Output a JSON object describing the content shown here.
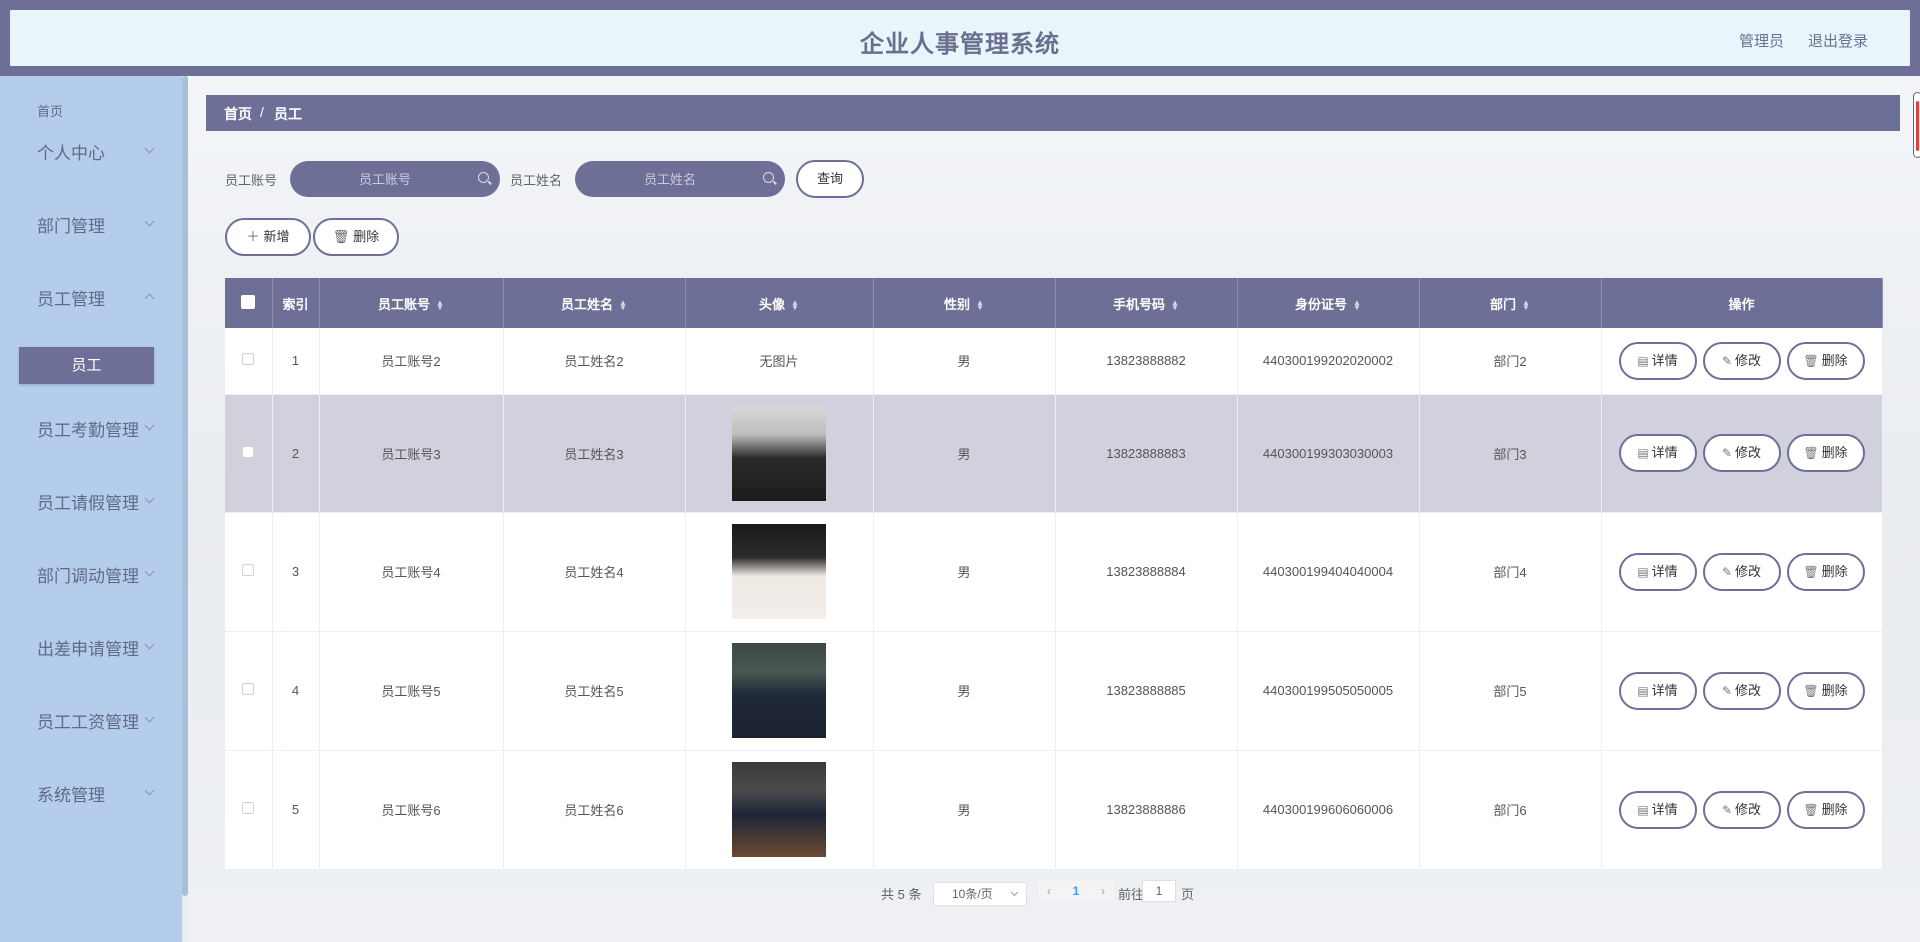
{
  "header": {
    "title": "企业人事管理系统",
    "user": "管理员",
    "logout": "退出登录"
  },
  "sidebar": {
    "home": "首页",
    "items": [
      {
        "label": "个人中心"
      },
      {
        "label": "部门管理"
      },
      {
        "label": "员工管理"
      },
      {
        "label": "员工考勤管理"
      },
      {
        "label": "员工请假管理"
      },
      {
        "label": "部门调动管理"
      },
      {
        "label": "出差申请管理"
      },
      {
        "label": "员工工资管理"
      },
      {
        "label": "系统管理"
      }
    ],
    "active_sub": "员工"
  },
  "breadcrumb": {
    "home": "首页",
    "sep": "/",
    "current": "员工"
  },
  "search": {
    "account_label": "员工账号",
    "account_placeholder": "员工账号",
    "name_label": "员工姓名",
    "name_placeholder": "员工姓名",
    "query": "查询"
  },
  "toolbar": {
    "add": "新增",
    "delete": "删除"
  },
  "table": {
    "headers": [
      "索引",
      "员工账号",
      "员工姓名",
      "头像",
      "性别",
      "手机号码",
      "身份证号",
      "部门",
      "操作"
    ],
    "rows": [
      {
        "index": "1",
        "account": "员工账号2",
        "name": "员工姓名2",
        "avatar": "无图片",
        "gender": "男",
        "phone": "13823888882",
        "id_no": "440300199202020002",
        "dept": "部门2"
      },
      {
        "index": "2",
        "account": "员工账号3",
        "name": "员工姓名3",
        "avatar": "",
        "gender": "男",
        "phone": "13823888883",
        "id_no": "440300199303030003",
        "dept": "部门3"
      },
      {
        "index": "3",
        "account": "员工账号4",
        "name": "员工姓名4",
        "avatar": "",
        "gender": "男",
        "phone": "13823888884",
        "id_no": "440300199404040004",
        "dept": "部门4"
      },
      {
        "index": "4",
        "account": "员工账号5",
        "name": "员工姓名5",
        "avatar": "",
        "gender": "男",
        "phone": "13823888885",
        "id_no": "440300199505050005",
        "dept": "部门5"
      },
      {
        "index": "5",
        "account": "员工账号6",
        "name": "员工姓名6",
        "avatar": "",
        "gender": "男",
        "phone": "13823888886",
        "id_no": "440300199606060006",
        "dept": "部门6"
      }
    ],
    "actions": {
      "detail": "详情",
      "edit": "修改",
      "delete": "删除"
    }
  },
  "pagination": {
    "total": "共 5 条",
    "page_size": "10条/页",
    "current": "1",
    "goto": "前往",
    "goto_value": "1",
    "page": "页"
  },
  "colors": {
    "primary": "#6e6f96",
    "sidebar": "#b5cdec",
    "header_bg": "#e8f6fc",
    "row_alt": "#d1d1de"
  }
}
